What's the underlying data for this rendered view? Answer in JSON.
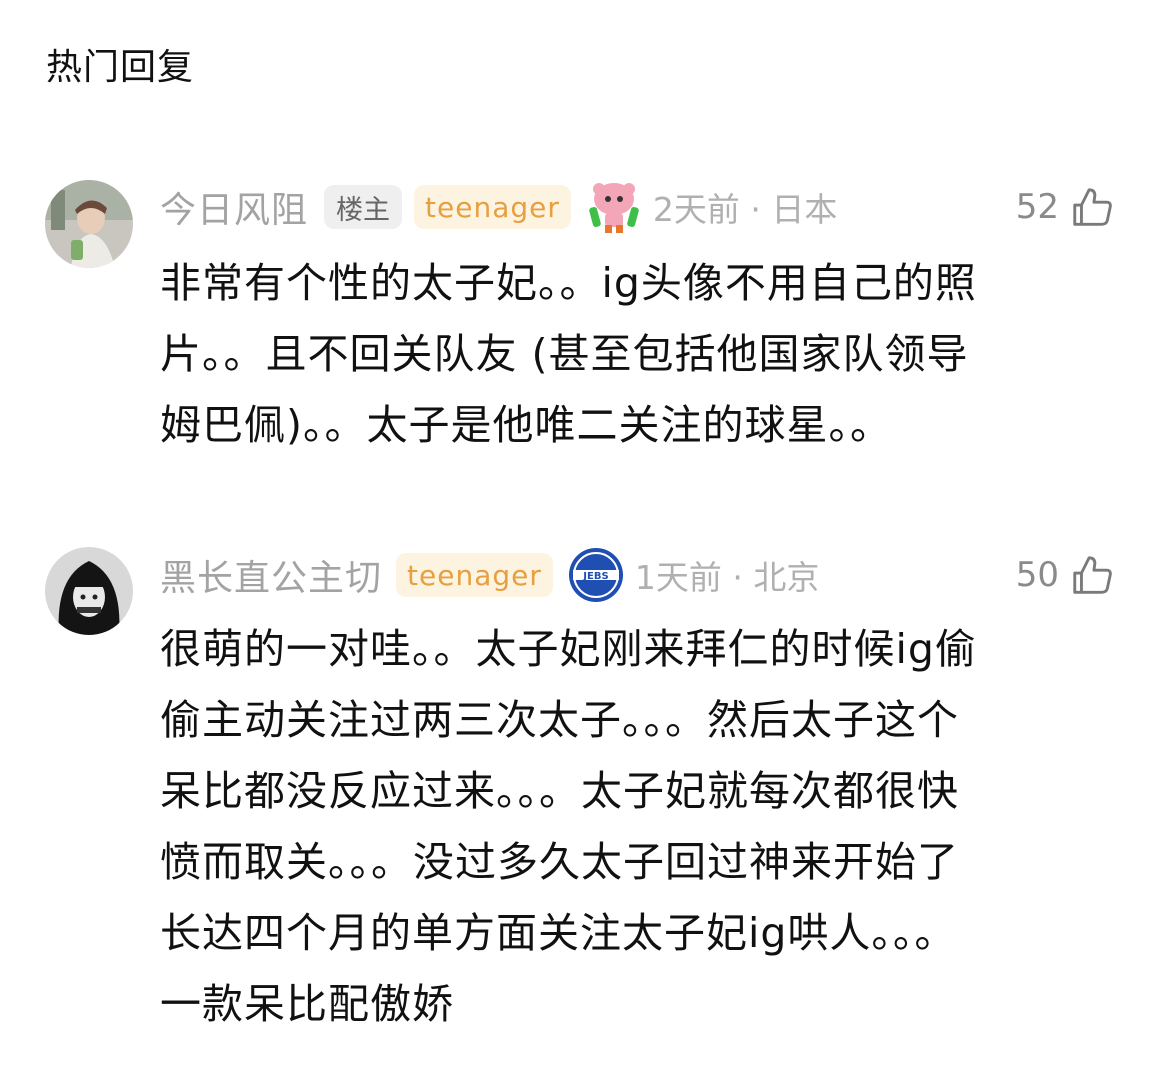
{
  "section_title": "热门回复",
  "comments": [
    {
      "username": "今日风阻",
      "badge_owner": "楼主",
      "badge_tag": "teenager",
      "sticker_icon": "pink-cartoon-sticker-icon",
      "meta": "2天前 · 日本",
      "likes": "52",
      "body_lines": [
        "非常有个性的太子妃。。ig头像不用自己的照",
        "片。。且不回关队友 (甚至包括他国家队领导",
        "姆巴佩)。。太子是他唯二关注的球星。。"
      ]
    },
    {
      "username": "黑长直公主切",
      "badge_tag": "teenager",
      "sticker_icon": "blue-club-logo-icon",
      "meta": "1天前 · 北京",
      "likes": "50",
      "body_lines": [
        "很萌的一对哇。。太子妃刚来拜仁的时候ig偷",
        "偷主动关注过两三次太子。。。然后太子这个",
        "呆比都没反应过来。。。太子妃就每次都很快",
        "愤而取关。。。没过多久太子回过神来开始了",
        "长达四个月的单方面关注太子妃ig哄人。。。",
        "一款呆比配傲娇"
      ]
    }
  ],
  "colors": {
    "username": "#a3a3a3",
    "meta": "#b0b0b0",
    "teen_badge_bg": "#fdf3e1",
    "teen_badge_text": "#e6a040",
    "owner_badge_bg": "#efefef",
    "like_count": "#8a8a8a"
  },
  "icons": {
    "like": "thumbs-up-icon"
  }
}
